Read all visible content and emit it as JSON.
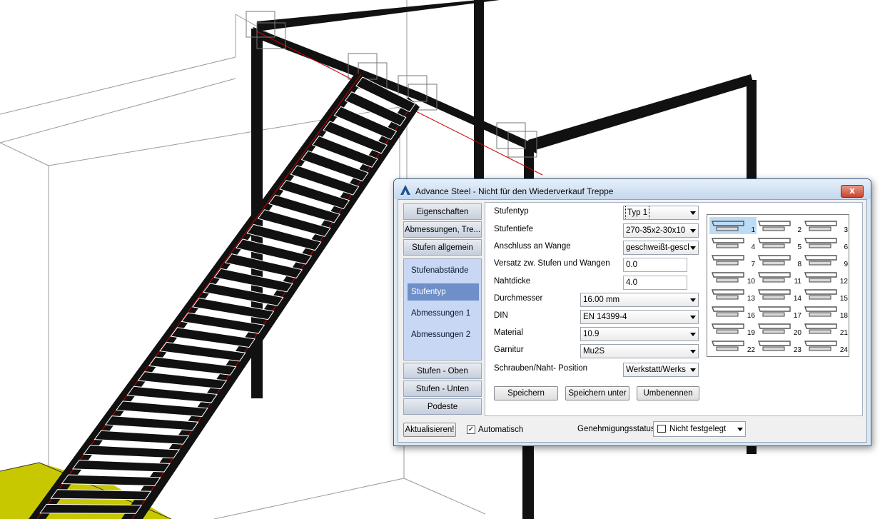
{
  "dialog": {
    "title": "Advance Steel - Nicht für den Wiederverkauf   Treppe",
    "close_label": "x"
  },
  "nav": {
    "top_buttons": [
      "Eigenschaften",
      "Abmessungen, Tre...",
      "Stufen allgemein"
    ],
    "sub_items": [
      "Stufenabstände",
      "Stufentyp",
      "Abmessungen 1",
      "Abmessungen 2"
    ],
    "selected_sub": "Stufentyp",
    "bottom_buttons": [
      "Stufen - Oben",
      "Stufen - Unten",
      "Podeste"
    ]
  },
  "form": {
    "stufentyp": {
      "label": "Stufentyp",
      "value": "Typ 1"
    },
    "stufentiefe": {
      "label": "Stufentiefe",
      "value": "270-35x2-30x10"
    },
    "anschluss": {
      "label": "Anschluss an Wange",
      "value": "geschweißt-gesch"
    },
    "versatz": {
      "label": "Versatz zw. Stufen und Wangen",
      "value": "0.0"
    },
    "nahtdicke": {
      "label": "Nahtdicke",
      "value": "4.0"
    },
    "durchmesser": {
      "label": "Durchmesser",
      "value": "16.00 mm"
    },
    "din": {
      "label": "DIN",
      "value": "EN 14399-4"
    },
    "material": {
      "label": "Material",
      "value": "10.9"
    },
    "garnitur": {
      "label": "Garnitur",
      "value": "Mu2S"
    },
    "schrauben": {
      "label": "Schrauben/Naht- Position",
      "value": "Werkstatt/Werks"
    }
  },
  "buttons": {
    "speichern": "Speichern",
    "speichern_unter": "Speichern unter",
    "umbenennen": "Umbenennen"
  },
  "step_types": [
    "1",
    "2",
    "3",
    "4",
    "5",
    "6",
    "7",
    "8",
    "9",
    "10",
    "11",
    "12",
    "13",
    "14",
    "15",
    "16",
    "17",
    "18",
    "19",
    "20",
    "21",
    "22",
    "23",
    "24"
  ],
  "selected_step_type": "1",
  "bottom": {
    "aktualisieren": "Aktualisieren!",
    "automatisch_label": "Automatisch",
    "automatisch_checked": true,
    "status_label": "Genehmigungsstatus",
    "status_value": "Nicht festgelegt"
  },
  "colors": {
    "steel": "#101010",
    "axis_line": "#cc0000",
    "ground": "#c8c800",
    "wire": "#888888"
  }
}
